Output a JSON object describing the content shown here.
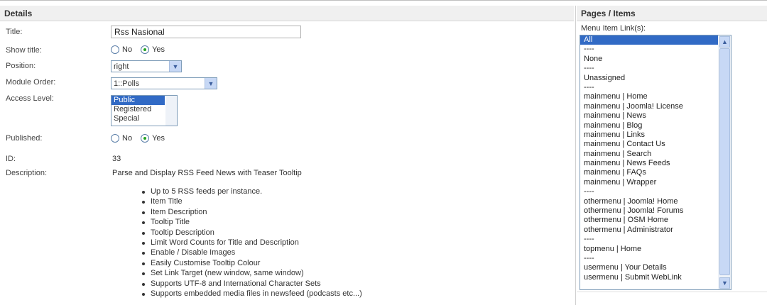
{
  "details": {
    "header": "Details",
    "title": {
      "label": "Title:",
      "value": "Rss Nasional"
    },
    "show_title": {
      "label": "Show title:",
      "no": "No",
      "yes": "Yes",
      "selected": "Yes"
    },
    "position": {
      "label": "Position:",
      "value": "right"
    },
    "module_order": {
      "label": "Module Order:",
      "value": "1::Polls"
    },
    "access_level": {
      "label": "Access Level:",
      "options": [
        "Public",
        "Registered",
        "Special"
      ],
      "selected": "Public"
    },
    "published": {
      "label": "Published:",
      "no": "No",
      "yes": "Yes",
      "selected": "Yes"
    },
    "id": {
      "label": "ID:",
      "value": "33"
    },
    "description": {
      "label": "Description:",
      "text": "Parse and Display RSS Feed News with Teaser Tooltip",
      "features": [
        "Up to 5 RSS feeds per instance.",
        "Item Title",
        "Item Description",
        "Tooltip Title",
        "Tooltip Description",
        "Limit Word Counts for Title and Description",
        "Enable / Disable Images",
        "Easily Customise Tooltip Colour",
        "Set Link Target (new window, same window)",
        "Supports UTF-8 and International Character Sets",
        "Supports embedded media files in newsfeed (podcasts etc...)"
      ]
    }
  },
  "pages": {
    "header": "Pages / Items",
    "menu_label": "Menu Item Link(s):",
    "items": [
      "All",
      "----",
      "None",
      "----",
      "Unassigned",
      "----",
      "mainmenu | Home",
      "mainmenu | Joomla! License",
      "mainmenu | News",
      "mainmenu | Blog",
      "mainmenu | Links",
      "mainmenu | Contact Us",
      "mainmenu | Search",
      "mainmenu | News Feeds",
      "mainmenu | FAQs",
      "mainmenu | Wrapper",
      "----",
      "othermenu | Joomla! Home",
      "othermenu | Joomla! Forums",
      "othermenu | OSM Home",
      "othermenu | Administrator",
      "----",
      "topmenu | Home",
      "----",
      "usermenu | Your Details",
      "usermenu | Submit WebLink"
    ],
    "selected": "All"
  },
  "colors": {
    "selection": "#316ac5",
    "radio_dot": "#21a321",
    "header_bg": "#f0f0f0"
  },
  "icons": {
    "dropdown": "chevron-down-icon",
    "scroll_up": "chevron-up-icon",
    "scroll_down": "chevron-down-icon"
  }
}
